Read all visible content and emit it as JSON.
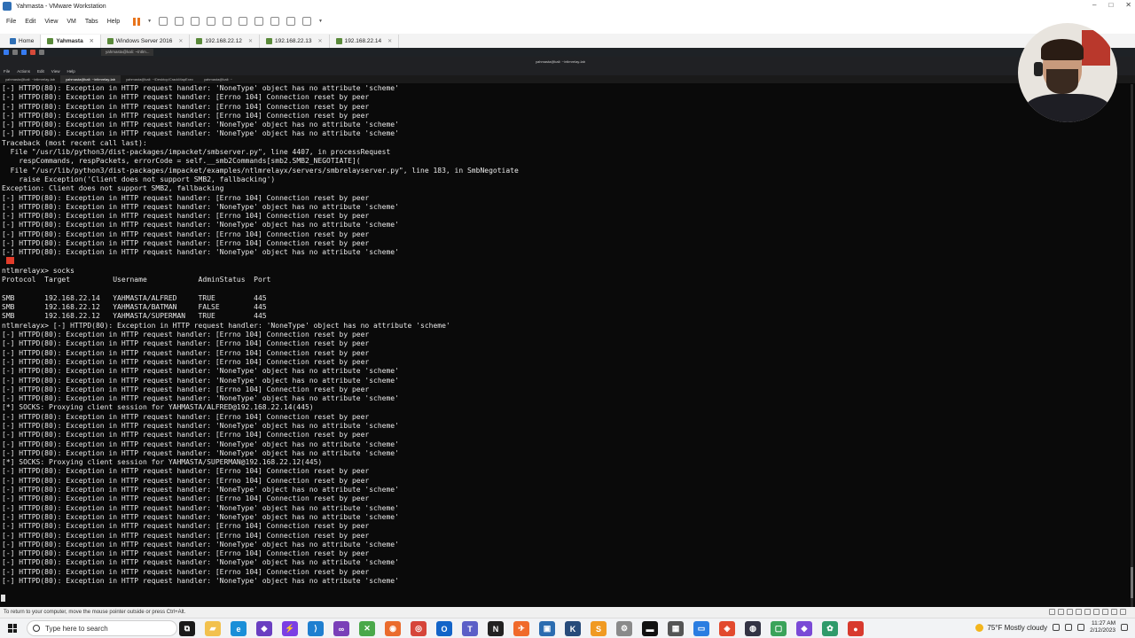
{
  "window": {
    "title": "Yahmasta - VMware Workstation",
    "controls": [
      "–",
      "□",
      "✕"
    ]
  },
  "menubar": {
    "items": [
      "File",
      "Edit",
      "View",
      "VM",
      "Tabs",
      "Help"
    ]
  },
  "vm_tabs": [
    {
      "label": "Home",
      "active": false
    },
    {
      "label": "Yahmasta",
      "active": true
    },
    {
      "label": "Windows Server 2016",
      "active": false
    },
    {
      "label": "192.168.22.12",
      "active": false
    },
    {
      "label": "192.168.22.13",
      "active": false
    },
    {
      "label": "192.168.22.14",
      "active": false
    }
  ],
  "kali": {
    "task_label": "yahmasta@kali: ~/ntlm...",
    "window_title": "yahmasta@kali: ~/ntlmrelay-lab",
    "term_menu": [
      "File",
      "Actions",
      "Edit",
      "View",
      "Help"
    ],
    "term_tabs": [
      {
        "label": "yahmasta@kali: ~/ntlmrelay-lab",
        "active": false
      },
      {
        "label": "yahmasta@kali: ~/ntlmrelay-lab",
        "active": true
      },
      {
        "label": "yahmasta@kali: ~/Desktop/CrackMapExec",
        "active": false
      },
      {
        "label": "yahmasta@kali: ~",
        "active": false
      }
    ]
  },
  "terminal": {
    "lines": [
      "[-] HTTPD(80): Exception in HTTP request handler: 'NoneType' object has no attribute 'scheme'",
      "[-] HTTPD(80): Exception in HTTP request handler: [Errno 104] Connection reset by peer",
      "[-] HTTPD(80): Exception in HTTP request handler: [Errno 104] Connection reset by peer",
      "[-] HTTPD(80): Exception in HTTP request handler: [Errno 104] Connection reset by peer",
      "[-] HTTPD(80): Exception in HTTP request handler: 'NoneType' object has no attribute 'scheme'",
      "[-] HTTPD(80): Exception in HTTP request handler: 'NoneType' object has no attribute 'scheme'",
      "Traceback (most recent call last):",
      "  File \"/usr/lib/python3/dist-packages/impacket/smbserver.py\", line 4407, in processRequest",
      "    respCommands, respPackets, errorCode = self.__smb2Commands[smb2.SMB2_NEGOTIATE](",
      "  File \"/usr/lib/python3/dist-packages/impacket/examples/ntlmrelayx/servers/smbrelayserver.py\", line 183, in SmbNegotiate",
      "    raise Exception('Client does not support SMB2, fallbacking')",
      "Exception: Client does not support SMB2, fallbacking",
      "[-] HTTPD(80): Exception in HTTP request handler: [Errno 104] Connection reset by peer",
      "[-] HTTPD(80): Exception in HTTP request handler: 'NoneType' object has no attribute 'scheme'",
      "[-] HTTPD(80): Exception in HTTP request handler: [Errno 104] Connection reset by peer",
      "[-] HTTPD(80): Exception in HTTP request handler: 'NoneType' object has no attribute 'scheme'",
      "[-] HTTPD(80): Exception in HTTP request handler: [Errno 104] Connection reset by peer",
      "[-] HTTPD(80): Exception in HTTP request handler: [Errno 104] Connection reset by peer",
      "[-] HTTPD(80): Exception in HTTP request handler: 'NoneType' object has no attribute 'scheme'",
      "",
      "ntlmrelayx> socks",
      "Protocol  Target          Username            AdminStatus  Port",
      "",
      "SMB       192.168.22.14   YAHMASTA/ALFRED     TRUE         445",
      "SMB       192.168.22.12   YAHMASTA/BATMAN     FALSE        445",
      "SMB       192.168.22.12   YAHMASTA/SUPERMAN   TRUE         445",
      "ntlmrelayx> [-] HTTPD(80): Exception in HTTP request handler: 'NoneType' object has no attribute 'scheme'",
      "[-] HTTPD(80): Exception in HTTP request handler: [Errno 104] Connection reset by peer",
      "[-] HTTPD(80): Exception in HTTP request handler: [Errno 104] Connection reset by peer",
      "[-] HTTPD(80): Exception in HTTP request handler: [Errno 104] Connection reset by peer",
      "[-] HTTPD(80): Exception in HTTP request handler: [Errno 104] Connection reset by peer",
      "[-] HTTPD(80): Exception in HTTP request handler: 'NoneType' object has no attribute 'scheme'",
      "[-] HTTPD(80): Exception in HTTP request handler: 'NoneType' object has no attribute 'scheme'",
      "[-] HTTPD(80): Exception in HTTP request handler: [Errno 104] Connection reset by peer",
      "[-] HTTPD(80): Exception in HTTP request handler: 'NoneType' object has no attribute 'scheme'",
      "[*] SOCKS: Proxying client session for YAHMASTA/ALFRED@192.168.22.14(445)",
      "[-] HTTPD(80): Exception in HTTP request handler: [Errno 104] Connection reset by peer",
      "[-] HTTPD(80): Exception in HTTP request handler: 'NoneType' object has no attribute 'scheme'",
      "[-] HTTPD(80): Exception in HTTP request handler: [Errno 104] Connection reset by peer",
      "[-] HTTPD(80): Exception in HTTP request handler: 'NoneType' object has no attribute 'scheme'",
      "[-] HTTPD(80): Exception in HTTP request handler: 'NoneType' object has no attribute 'scheme'",
      "[*] SOCKS: Proxying client session for YAHMASTA/SUPERMAN@192.168.22.12(445)",
      "[-] HTTPD(80): Exception in HTTP request handler: [Errno 104] Connection reset by peer",
      "[-] HTTPD(80): Exception in HTTP request handler: [Errno 104] Connection reset by peer",
      "[-] HTTPD(80): Exception in HTTP request handler: 'NoneType' object has no attribute 'scheme'",
      "[-] HTTPD(80): Exception in HTTP request handler: [Errno 104] Connection reset by peer",
      "[-] HTTPD(80): Exception in HTTP request handler: 'NoneType' object has no attribute 'scheme'",
      "[-] HTTPD(80): Exception in HTTP request handler: 'NoneType' object has no attribute 'scheme'",
      "[-] HTTPD(80): Exception in HTTP request handler: [Errno 104] Connection reset by peer",
      "[-] HTTPD(80): Exception in HTTP request handler: [Errno 104] Connection reset by peer",
      "[-] HTTPD(80): Exception in HTTP request handler: 'NoneType' object has no attribute 'scheme'",
      "[-] HTTPD(80): Exception in HTTP request handler: [Errno 104] Connection reset by peer",
      "[-] HTTPD(80): Exception in HTTP request handler: 'NoneType' object has no attribute 'scheme'",
      "[-] HTTPD(80): Exception in HTTP request handler: [Errno 104] Connection reset by peer",
      "[-] HTTPD(80): Exception in HTTP request handler: 'NoneType' object has no attribute 'scheme'"
    ]
  },
  "statusbar": {
    "hint": "To return to your computer, move the mouse pointer outside or press Ctrl+Alt."
  },
  "taskbar": {
    "search_placeholder": "Type here to search",
    "apps": [
      {
        "name": "task-view-icon",
        "color": "#1a1a1a",
        "glyph": "⧉"
      },
      {
        "name": "file-explorer-icon",
        "color": "#f2c14e",
        "glyph": "▰"
      },
      {
        "name": "edge-icon",
        "color": "#1b8fd8",
        "glyph": "e"
      },
      {
        "name": "obsidian-icon",
        "color": "#6a3fc1",
        "glyph": "◆"
      },
      {
        "name": "app-purple-icon",
        "color": "#7b3fe4",
        "glyph": "⚡"
      },
      {
        "name": "vscode-icon",
        "color": "#1f7fd0",
        "glyph": "⟩"
      },
      {
        "name": "visual-studio-icon",
        "color": "#7a3fb8",
        "glyph": "∞"
      },
      {
        "name": "terminal-green-icon",
        "color": "#4aa84a",
        "glyph": "✕"
      },
      {
        "name": "firefox-icon",
        "color": "#ea6b2d",
        "glyph": "◉"
      },
      {
        "name": "chrome-icon",
        "color": "#d6453a",
        "glyph": "◎"
      },
      {
        "name": "outlook-icon",
        "color": "#1364c8",
        "glyph": "O"
      },
      {
        "name": "teams-icon",
        "color": "#5b5fc7",
        "glyph": "T"
      },
      {
        "name": "notion-icon",
        "color": "#222222",
        "glyph": "N"
      },
      {
        "name": "postman-icon",
        "color": "#f06a2b",
        "glyph": "✈"
      },
      {
        "name": "vmware-icon",
        "color": "#2b6cb0",
        "glyph": "▣"
      },
      {
        "name": "kali-icon",
        "color": "#274b7a",
        "glyph": "K"
      },
      {
        "name": "sublime-icon",
        "color": "#f09a22",
        "glyph": "S"
      },
      {
        "name": "settings-icon",
        "color": "#8a8a8a",
        "glyph": "⚙"
      },
      {
        "name": "cmd-icon",
        "color": "#111111",
        "glyph": "▬"
      },
      {
        "name": "calculator-icon",
        "color": "#555555",
        "glyph": "▦"
      },
      {
        "name": "app-blue-icon",
        "color": "#2a7de1",
        "glyph": "▭"
      },
      {
        "name": "app-red-icon",
        "color": "#e24a2e",
        "glyph": "◈"
      },
      {
        "name": "obs-icon",
        "color": "#333344",
        "glyph": "◍"
      },
      {
        "name": "app-green-icon",
        "color": "#3aa35a",
        "glyph": "▢"
      },
      {
        "name": "app-purple2-icon",
        "color": "#7a4ad6",
        "glyph": "◆"
      },
      {
        "name": "app-teal-icon",
        "color": "#2f9a6a",
        "glyph": "✿"
      },
      {
        "name": "app-red2-icon",
        "color": "#d83a2e",
        "glyph": "●"
      }
    ],
    "weather": "75°F  Mostly cloudy",
    "time": "11:27 AM",
    "date": "2/12/2023"
  }
}
